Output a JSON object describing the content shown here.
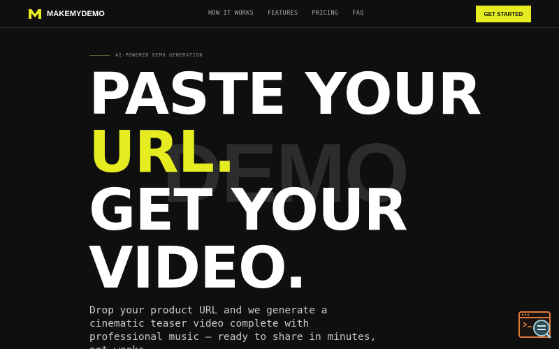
{
  "brand": {
    "name": "MAKEMYDEMO",
    "logo_icon": "m-logo-icon",
    "accent": "#e5ec1f"
  },
  "nav": {
    "links": [
      "HOW IT WORKS",
      "FEATURES",
      "PRICING",
      "FAQ"
    ],
    "cta_label": "GET STARTED"
  },
  "hero": {
    "eyebrow": "AI-POWERED DEMO GENERATION",
    "watermark": "DEMO",
    "headline": {
      "line1": "PASTE YOUR",
      "line2": "URL.",
      "line3": "GET YOUR",
      "line4": "VIDEO."
    },
    "subtext": "Drop your product URL and we generate a cinematic teaser video complete with professional music — ready to share in minutes, not weeks."
  },
  "widget": {
    "icon": "terminal-search-icon"
  },
  "colors": {
    "background": "#0f0f0f",
    "accent": "#e5ec1f",
    "text": "#ffffff",
    "muted": "#a9a9a9"
  }
}
